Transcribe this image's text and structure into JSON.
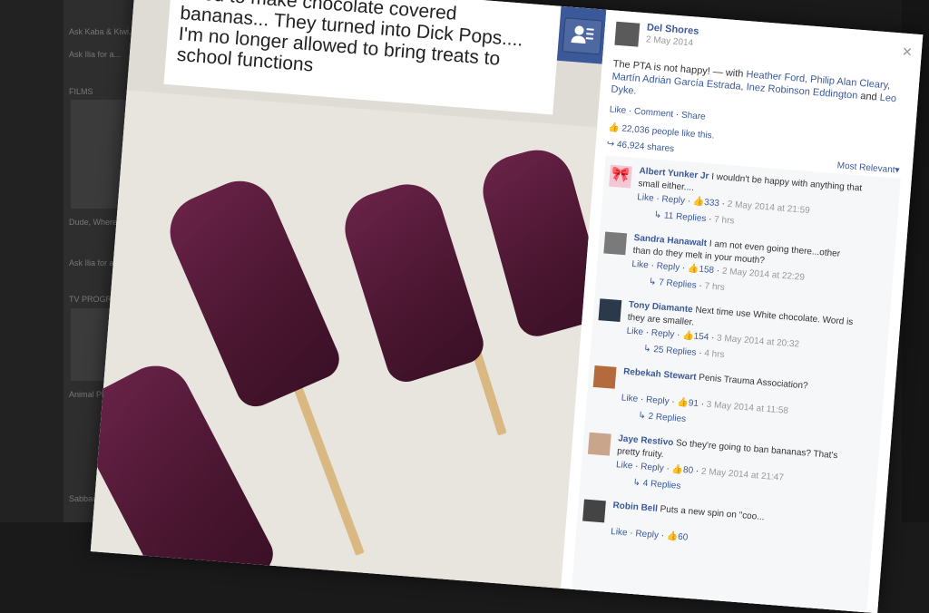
{
  "background": {
    "items": [
      "Ask Kaba & Kiwi...",
      "Ask Ilia for a...",
      "FILMS",
      "Dude, Where's My Car?",
      "Ask Ilia for a...",
      "TV PROGRAM",
      "Animal Planet Top Cu",
      "Sabbady"
    ]
  },
  "post": {
    "text": "Tried to make chocolate covered bananas... They turned into Dick Pops.... I'm no longer allowed to bring treats to school functions"
  },
  "sidebar": {
    "author": "Del Shores",
    "date": "2 May 2014",
    "caption": "The PTA is not happy! — with",
    "tagged": "Heather Ford, Philip Alan Cleary, Martín Adrián García Estrada, Inez Robinson Eddington",
    "and_label": "and",
    "last_tag": "Leo Dyke.",
    "actions": {
      "like": "Like",
      "comment": "Comment",
      "share": "Share"
    },
    "likes_text": "22,036 people like this.",
    "shares_text": "46,924 shares",
    "sort_label": "Most Relevant"
  },
  "comments": [
    {
      "name": "Albert Yunker Jr",
      "text": "I wouldn't be happy with anything that small either....",
      "like": "Like",
      "reply": "Reply",
      "likes": "333",
      "time": "2 May 2014 at 21:59",
      "replies": "11 Replies",
      "ago": "7 hrs"
    },
    {
      "name": "Sandra Hanawalt",
      "text": "I am not even going there...other than do they melt in your mouth?",
      "like": "Like",
      "reply": "Reply",
      "likes": "158",
      "time": "2 May 2014 at 22:29",
      "replies": "7 Replies",
      "ago": "7 hrs"
    },
    {
      "name": "Tony Diamante",
      "text": "Next time use White chocolate. Word is they are smaller.",
      "like": "Like",
      "reply": "Reply",
      "likes": "154",
      "time": "3 May 2014 at 20:32",
      "replies": "25 Replies",
      "ago": "4 hrs"
    },
    {
      "name": "Rebekah Stewart",
      "text": "Penis Trauma Association?",
      "like": "Like",
      "reply": "Reply",
      "likes": "91",
      "time": "3 May 2014 at 11:58",
      "replies": "2 Replies",
      "ago": ""
    },
    {
      "name": "Jaye Restivo",
      "text": "So they're going to ban bananas? That's pretty fruity.",
      "like": "Like",
      "reply": "Reply",
      "likes": "80",
      "time": "2 May 2014 at 21:47",
      "replies": "4 Replies",
      "ago": ""
    },
    {
      "name": "Robin Bell",
      "text": "Puts a new spin on \"coo...",
      "like": "Like",
      "reply": "Reply",
      "likes": "60",
      "time": "",
      "replies": "",
      "ago": ""
    }
  ]
}
